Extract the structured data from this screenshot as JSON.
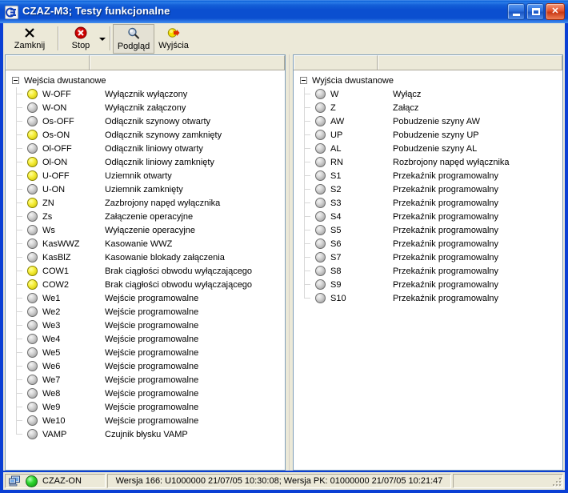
{
  "window": {
    "title": "CZAZ-M3; Testy funkcjonalne",
    "icon": "app-icon",
    "minimize_label": "_",
    "maximize_label": "□",
    "close_label": "✕"
  },
  "toolbar": {
    "items": [
      {
        "label": "Zamknij",
        "icon": "close-x-icon",
        "pressed": false,
        "dropdown": false
      },
      {
        "label": "Stop",
        "icon": "stop-circle-icon",
        "pressed": false,
        "dropdown": true
      },
      {
        "label": "Podgląd",
        "icon": "magnifier-icon",
        "pressed": true,
        "dropdown": false
      },
      {
        "label": "Wyjścia",
        "icon": "output-arrow-icon",
        "pressed": false,
        "dropdown": false
      }
    ]
  },
  "left_panel": {
    "column_headers": [
      "",
      ""
    ],
    "root_label": "Wejścia dwustanowe",
    "items": [
      {
        "code": "W-OFF",
        "desc": "Wyłącznik wyłączony",
        "state": "on"
      },
      {
        "code": "W-ON",
        "desc": "Wyłącznik załączony",
        "state": "off"
      },
      {
        "code": "Os-OFF",
        "desc": "Odłącznik szynowy otwarty",
        "state": "off"
      },
      {
        "code": "Os-ON",
        "desc": "Odłącznik szynowy zamknięty",
        "state": "on"
      },
      {
        "code": "Ol-OFF",
        "desc": "Odłącznik liniowy otwarty",
        "state": "off"
      },
      {
        "code": "Ol-ON",
        "desc": "Odłącznik liniowy zamknięty",
        "state": "on"
      },
      {
        "code": "U-OFF",
        "desc": "Uziemnik otwarty",
        "state": "on"
      },
      {
        "code": "U-ON",
        "desc": "Uziemnik zamknięty",
        "state": "off"
      },
      {
        "code": "ZN",
        "desc": "Zazbrojony napęd wyłącznika",
        "state": "on"
      },
      {
        "code": "Zs",
        "desc": "Załączenie operacyjne",
        "state": "off"
      },
      {
        "code": "Ws",
        "desc": "Wyłączenie operacyjne",
        "state": "off"
      },
      {
        "code": "KasWWZ",
        "desc": "Kasowanie WWZ",
        "state": "off"
      },
      {
        "code": "KasBlZ",
        "desc": "Kasowanie blokady załączenia",
        "state": "off"
      },
      {
        "code": "COW1",
        "desc": "Brak ciągłości obwodu wyłączającego",
        "state": "on"
      },
      {
        "code": "COW2",
        "desc": "Brak ciągłości obwodu wyłączającego",
        "state": "on"
      },
      {
        "code": "We1",
        "desc": "Wejście programowalne",
        "state": "off"
      },
      {
        "code": "We2",
        "desc": "Wejście programowalne",
        "state": "off"
      },
      {
        "code": "We3",
        "desc": "Wejście programowalne",
        "state": "off"
      },
      {
        "code": "We4",
        "desc": "Wejście programowalne",
        "state": "off"
      },
      {
        "code": "We5",
        "desc": "Wejście programowalne",
        "state": "off"
      },
      {
        "code": "We6",
        "desc": "Wejście programowalne",
        "state": "off"
      },
      {
        "code": "We7",
        "desc": "Wejście programowalne",
        "state": "off"
      },
      {
        "code": "We8",
        "desc": "Wejście programowalne",
        "state": "off"
      },
      {
        "code": "We9",
        "desc": "Wejście programowalne",
        "state": "off"
      },
      {
        "code": "We10",
        "desc": "Wejście programowalne",
        "state": "off"
      },
      {
        "code": "VAMP",
        "desc": "Czujnik błysku VAMP",
        "state": "off"
      }
    ]
  },
  "right_panel": {
    "column_headers": [
      "",
      ""
    ],
    "root_label": "Wyjścia dwustanowe",
    "items": [
      {
        "code": "W",
        "desc": "Wyłącz",
        "state": "off"
      },
      {
        "code": "Z",
        "desc": "Załącz",
        "state": "off"
      },
      {
        "code": "AW",
        "desc": "Pobudzenie szyny AW",
        "state": "off"
      },
      {
        "code": "UP",
        "desc": "Pobudzenie szyny UP",
        "state": "off"
      },
      {
        "code": "AL",
        "desc": "Pobudzenie szyny AL",
        "state": "off"
      },
      {
        "code": "RN",
        "desc": "Rozbrojony napęd wyłącznika",
        "state": "off"
      },
      {
        "code": "S1",
        "desc": "Przekaźnik programowalny",
        "state": "off"
      },
      {
        "code": "S2",
        "desc": "Przekaźnik programowalny",
        "state": "off"
      },
      {
        "code": "S3",
        "desc": "Przekaźnik programowalny",
        "state": "off"
      },
      {
        "code": "S4",
        "desc": "Przekaźnik programowalny",
        "state": "off"
      },
      {
        "code": "S5",
        "desc": "Przekaźnik programowalny",
        "state": "off"
      },
      {
        "code": "S6",
        "desc": "Przekaźnik programowalny",
        "state": "off"
      },
      {
        "code": "S7",
        "desc": "Przekaźnik programowalny",
        "state": "off"
      },
      {
        "code": "S8",
        "desc": "Przekaźnik programowalny",
        "state": "off"
      },
      {
        "code": "S9",
        "desc": "Przekaźnik programowalny",
        "state": "off"
      },
      {
        "code": "S10",
        "desc": "Przekaźnik programowalny",
        "state": "off"
      }
    ]
  },
  "statusbar": {
    "connection_icon": "computer-icon",
    "connection_led": "green-led-icon",
    "connection_label": "CZAZ-ON",
    "version_text": "Wersja 166: U1000000 21/07/05 10:30:08; Wersja PK: 01000000 21/07/05 10:21:47",
    "spare_text": ""
  },
  "colors": {
    "titlebar_blue": "#0b4fd0",
    "face": "#ece9d8",
    "led_on": "#f7ef3c",
    "led_off": "#c8c8c8",
    "status_led": "#2fd82f"
  }
}
